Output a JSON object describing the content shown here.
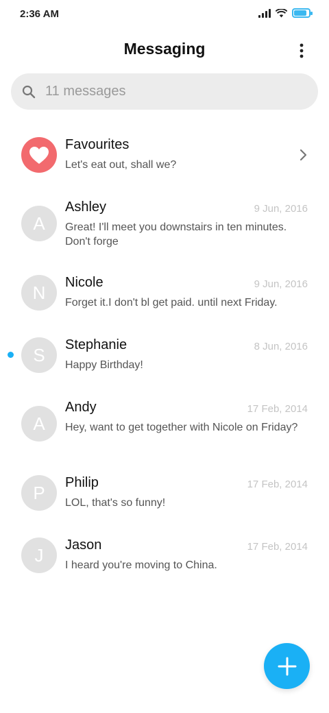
{
  "status_bar": {
    "time": "2:36 AM",
    "battery_level": 0.85
  },
  "header": {
    "title": "Messaging"
  },
  "search": {
    "placeholder": "11 messages"
  },
  "favourites": {
    "name": "Favourites",
    "preview": "Let's eat out, shall we?"
  },
  "conversations": [
    {
      "initial": "A",
      "name": "Ashley",
      "date": "9 Jun, 2016",
      "preview": "Great! I'll meet you downstairs in ten minutes. Don't forge",
      "unread": false
    },
    {
      "initial": "N",
      "name": "Nicole",
      "date": "9 Jun, 2016",
      "preview": "Forget it.I don't bl get paid. until next Friday.",
      "unread": false
    },
    {
      "initial": "S",
      "name": "Stephanie",
      "date": "8 Jun, 2016",
      "preview": "Happy Birthday!",
      "unread": true
    },
    {
      "initial": "A",
      "name": "Andy",
      "date": "17 Feb, 2014",
      "preview": "Hey, want to get together with Nicole on Friday?",
      "unread": false
    },
    {
      "initial": "P",
      "name": "Philip",
      "date": "17 Feb, 2014",
      "preview": "LOL, that's so funny!",
      "unread": false
    },
    {
      "initial": "J",
      "name": "Jason",
      "date": "17 Feb, 2014",
      "preview": "I heard you're moving to China.",
      "unread": false
    }
  ],
  "colors": {
    "accent": "#1ab0f5",
    "favourite": "#f26a6e",
    "avatar": "#e1e1e1",
    "search_bg": "#ececec"
  },
  "icons": {
    "more": "more-vertical-icon",
    "search": "search-icon",
    "favourite": "heart-icon",
    "chevron": "chevron-right-icon",
    "fab": "plus-icon"
  }
}
